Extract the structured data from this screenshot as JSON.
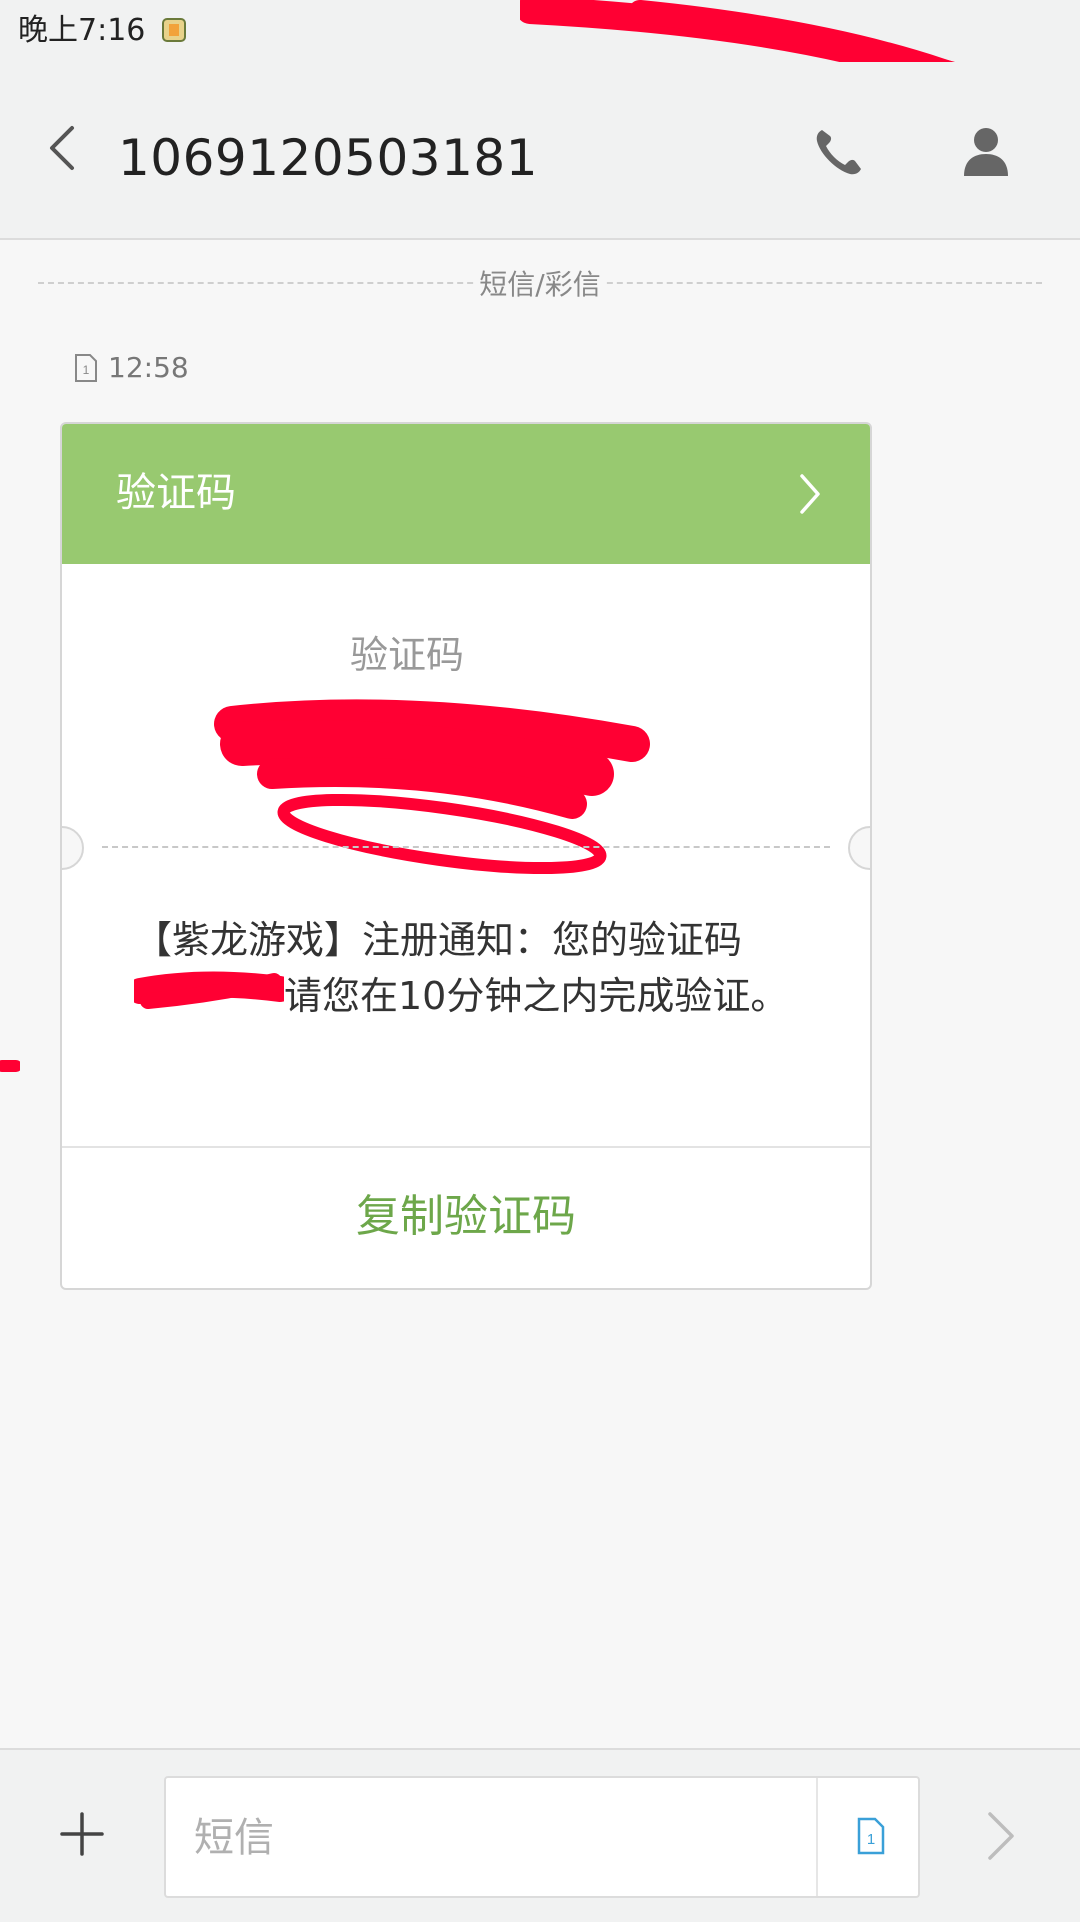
{
  "status_bar": {
    "time": "晚上7:16",
    "notification_icon": "app-notification-icon"
  },
  "header": {
    "title": "1069120503181",
    "back_icon": "chevron-left-icon",
    "call_icon": "phone-icon",
    "contact_icon": "person-icon"
  },
  "thread": {
    "divider_label": "短信/彩信",
    "message": {
      "sim_icon": "sim-1-icon",
      "time": "12:58",
      "card": {
        "header_title": "验证码",
        "code_label": "验证码",
        "body_part1": "【紫龙游戏】注册通知：您的验证码",
        "body_part2": "请您在10分钟之内完成验证。",
        "copy_button": "复制验证码"
      }
    }
  },
  "compose": {
    "placeholder": "短信",
    "add_icon": "plus-icon",
    "sim_icon": "sim-1-icon",
    "send_icon": "chevron-right-icon"
  },
  "colors": {
    "accent_green": "#98c970",
    "link_green": "#6da74a",
    "redaction": "#ff0033"
  }
}
